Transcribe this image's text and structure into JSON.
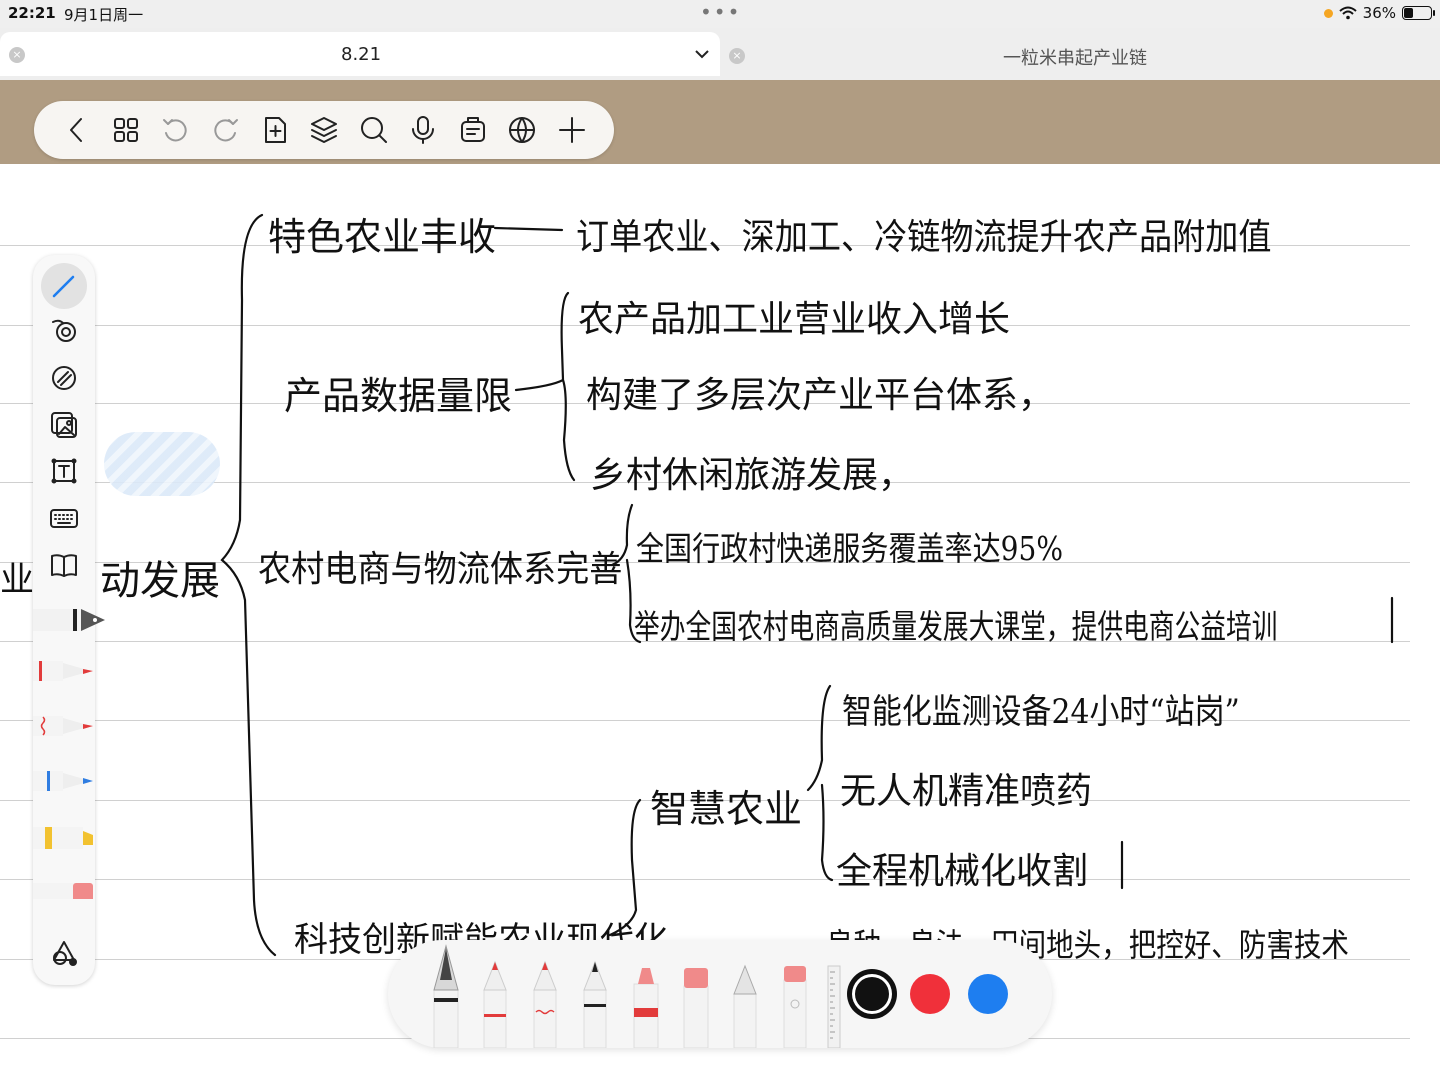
{
  "status_bar": {
    "time": "22:21",
    "date": "9月1日周一",
    "battery": "36%",
    "battery_level": 0.36
  },
  "tabs": [
    {
      "title": "8.21",
      "active": true
    },
    {
      "title": "一粒米串起产业链",
      "active": false
    }
  ],
  "toolbar": {
    "icons": [
      "back-icon",
      "grid-icon",
      "undo-icon",
      "redo-icon",
      "add-page-icon",
      "layers-icon",
      "search-icon",
      "microphone-icon",
      "clipboard-icon",
      "globe-icon",
      "plus-icon"
    ]
  },
  "side_tools": {
    "icons": [
      "pen-icon",
      "lasso-icon",
      "eraser-icon",
      "image-icon",
      "textbox-icon",
      "keyboard-icon",
      "book-icon",
      "shapes-icon"
    ],
    "pen_colors": [
      "#333333",
      "#e23b3b",
      "#e23b3b",
      "#2f7de1",
      "#f2c230",
      "#f08a8a"
    ]
  },
  "handwriting": {
    "root_left": "业",
    "root": "动发展",
    "branch1": "特色农业丰收",
    "branch1_detail": "订单农业、深加工、冷链物流提升农产品附加值",
    "branch2": "产品数据量限",
    "branch2_items": [
      "农产品加工业营业收入增长",
      "构建了多层次产业平台体系，",
      "乡村休闲旅游发展，"
    ],
    "branch3": "农村电商与物流体系完善",
    "branch3_items": [
      "全国行政村快递服务覆盖率达95%",
      "举办全国农村电商高质量发展大课堂，提供电商公益培训"
    ],
    "branch4": "科技创新赋能农业现代化",
    "sub_branch": "智慧农业",
    "sub_items": [
      "智能化监测设备24小时“站岗”",
      "无人机精准喷药",
      "全程机械化收割"
    ],
    "bottom_partial": "良种、良法、田间地头，把控好、防害技术"
  },
  "pen_tray": {
    "colors": [
      "#111111",
      "#f0303a",
      "#1e7ef0"
    ]
  }
}
